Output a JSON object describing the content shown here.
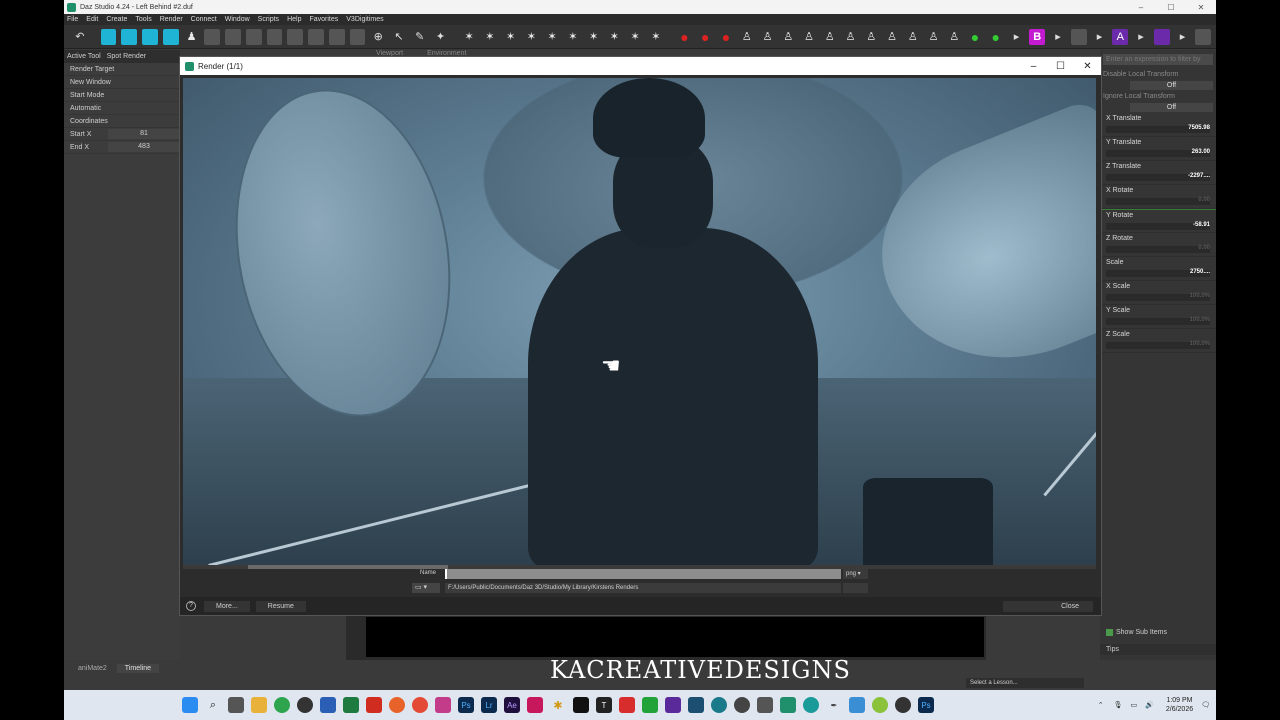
{
  "app": {
    "title": "Daz Studio 4.24 - Left Behind #2.duf",
    "window_controls": [
      "–",
      "☐",
      "✕"
    ]
  },
  "menu": [
    "File",
    "Edit",
    "Create",
    "Tools",
    "Render",
    "Connect",
    "Window",
    "Scripts",
    "Help",
    "Favorites",
    "V3Digitimes"
  ],
  "left_panel": {
    "tab_active_tool": "Active Tool",
    "tab_spot_render": "Spot Render",
    "rows": [
      {
        "label": "Render Target",
        "value": ""
      },
      {
        "label": "New Window",
        "value": ""
      },
      {
        "label": "Start Mode",
        "value": ""
      },
      {
        "label": "Automatic",
        "value": ""
      },
      {
        "label": "Coordinates",
        "value": ""
      },
      {
        "label": "Start X",
        "value": "81"
      },
      {
        "label": "End X",
        "value": "483"
      }
    ]
  },
  "viewport_tabs": [
    "Viewport",
    "Environment"
  ],
  "render_window": {
    "title": "Render (1/1)",
    "name_label": "Name",
    "name_value": "",
    "format": "png ▾",
    "path": "F:/Users/Public/Documents/Daz 3D/Studio/My Library/Kirstens Renders",
    "buttons": {
      "more": "More...",
      "resume": "Resume",
      "close": "Close"
    }
  },
  "right_panel": {
    "filter_placeholder": "Enter an expression to filter by",
    "disable_local_transform": "Disable Local Transform",
    "off_1": "Off",
    "ignore_local_transform": "Ignore Local Transform",
    "off_2": "Off",
    "sliders": [
      {
        "label": "X Translate",
        "value": "7505.98",
        "dim": false
      },
      {
        "label": "Y Translate",
        "value": "263.00",
        "dim": false
      },
      {
        "label": "Z Translate",
        "value": "-2297....",
        "dim": false
      },
      {
        "label": "X Rotate",
        "value": "0.00",
        "dim": true
      },
      {
        "label": "Y Rotate",
        "value": "-58.91",
        "dim": false
      },
      {
        "label": "Z Rotate",
        "value": "0.00",
        "dim": true
      },
      {
        "label": "Scale",
        "value": "2750....",
        "dim": false
      },
      {
        "label": "X Scale",
        "value": "100.0%",
        "dim": true
      },
      {
        "label": "Y Scale",
        "value": "100.0%",
        "dim": true
      },
      {
        "label": "Z Scale",
        "value": "100.0%",
        "dim": true
      }
    ],
    "show_sub_items": "Show Sub Items",
    "tips": "Tips"
  },
  "bottom": {
    "tabs": [
      "aniMate2",
      "Timeline"
    ],
    "lesson_placeholder": "Select a Lesson...",
    "watermark": "KACREATIVEDESIGNS"
  },
  "taskbar": {
    "time": "1:09 PM",
    "date": "2/6/2026"
  },
  "colors": {
    "accent_cyan": "#1fb4d6",
    "daz_green": "#1f8f6c"
  }
}
